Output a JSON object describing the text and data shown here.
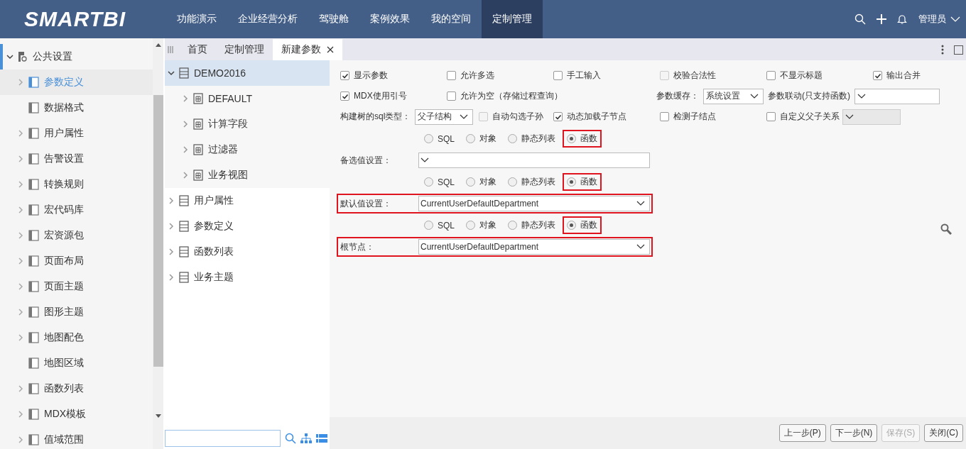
{
  "brand": {
    "logo": "SMARTBI"
  },
  "nav": [
    {
      "label": "功能演示",
      "selected": false
    },
    {
      "label": "企业经营分析",
      "selected": false
    },
    {
      "label": "驾驶舱",
      "selected": false
    },
    {
      "label": "案例效果",
      "selected": false
    },
    {
      "label": "我的空间",
      "selected": false
    },
    {
      "label": "定制管理",
      "selected": true
    }
  ],
  "user": {
    "name": "管理员"
  },
  "sidebar": {
    "items": [
      {
        "label": "公共设置",
        "expanded": true,
        "selected": false,
        "children": [
          {
            "label": "参数定义",
            "expandable": true,
            "selected": true
          },
          {
            "label": "数据格式",
            "expandable": false,
            "selected": false
          },
          {
            "label": "用户属性",
            "expandable": true,
            "selected": false
          },
          {
            "label": "告警设置",
            "expandable": true,
            "selected": false
          },
          {
            "label": "转换规则",
            "expandable": true,
            "selected": false
          },
          {
            "label": "宏代码库",
            "expandable": true,
            "selected": false
          },
          {
            "label": "宏资源包",
            "expandable": true,
            "selected": false
          },
          {
            "label": "页面布局",
            "expandable": true,
            "selected": false
          },
          {
            "label": "页面主题",
            "expandable": true,
            "selected": false
          },
          {
            "label": "图形主题",
            "expandable": true,
            "selected": false
          },
          {
            "label": "地图配色",
            "expandable": true,
            "selected": false
          },
          {
            "label": "地图区域",
            "expandable": false,
            "selected": false
          },
          {
            "label": "函数列表",
            "expandable": true,
            "selected": false
          },
          {
            "label": "MDX模板",
            "expandable": true,
            "selected": false
          },
          {
            "label": "值域范围",
            "expandable": true,
            "selected": false
          }
        ]
      }
    ]
  },
  "tabs": [
    {
      "label": "首页",
      "selected": false,
      "closable": false
    },
    {
      "label": "定制管理",
      "selected": false,
      "closable": false
    },
    {
      "label": "新建参数",
      "selected": true,
      "closable": true
    }
  ],
  "tree": {
    "items": [
      {
        "label": "DEMO2016",
        "expanded": true,
        "selected": true,
        "children": [
          {
            "label": "DEFAULT",
            "expanded": false,
            "selected": false
          },
          {
            "label": "计算字段",
            "expanded": false,
            "selected": false
          },
          {
            "label": "过滤器",
            "expanded": false,
            "selected": false
          },
          {
            "label": "业务视图",
            "expanded": false,
            "selected": false
          }
        ]
      },
      {
        "label": "用户属性",
        "expanded": false,
        "selected": false
      },
      {
        "label": "参数定义",
        "expanded": false,
        "selected": false
      },
      {
        "label": "函数列表",
        "expanded": false,
        "selected": false
      },
      {
        "label": "业务主题",
        "expanded": false,
        "selected": false
      }
    ]
  },
  "options": {
    "rows": [
      [
        {
          "kind": "checkbox",
          "label": "显示参数",
          "checked": true,
          "disabled": false
        },
        {
          "kind": "checkbox",
          "label": "允许多选",
          "checked": false,
          "disabled": false
        },
        {
          "kind": "checkbox",
          "label": "手工输入",
          "checked": false,
          "disabled": false
        },
        {
          "kind": "checkbox",
          "label": "校验合法性",
          "checked": false,
          "disabled": true
        },
        {
          "kind": "checkbox",
          "label": "不显示标题",
          "checked": false,
          "disabled": false
        },
        {
          "kind": "checkbox",
          "label": "输出合并",
          "checked": true,
          "disabled": false
        }
      ],
      [
        {
          "kind": "checkbox",
          "label": "MDX使用引号",
          "checked": true,
          "disabled": false
        },
        {
          "kind": "checkbox",
          "label": "允许为空（存储过程查询）",
          "checked": false,
          "disabled": false
        },
        "",
        {
          "kind": "select",
          "label": "参数缓存：",
          "value": "系统设置",
          "disabled": false
        },
        {
          "kind": "select",
          "label": "参数联动(只支持函数)",
          "disabled": false
        }
      ],
      [
        {
          "kind": "select",
          "label": "构建树的sql类型：",
          "value": "父子结构",
          "disabled": false
        },
        {
          "kind": "checkbox",
          "label": "自动勾选子孙",
          "checked": false,
          "disabled": true
        },
        {
          "kind": "checkbox",
          "label": "动态加载子节点",
          "checked": true,
          "disabled": false
        },
        {
          "kind": "checkbox",
          "label": "检测子结点",
          "checked": false,
          "disabled": false
        },
        {
          "kind": "checkbox",
          "label": "自定义父子关系",
          "checked": false,
          "disabled": false
        },
        {
          "kind": "select",
          "disabled": true
        }
      ]
    ]
  },
  "sections": [
    {
      "radios": [
        {
          "label": "SQL",
          "selected": false,
          "highlighted": false
        },
        {
          "label": "对象",
          "selected": false,
          "highlighted": false
        },
        {
          "label": "静态列表",
          "selected": false,
          "highlighted": false
        },
        {
          "label": "函数",
          "selected": true,
          "highlighted": true
        }
      ],
      "field": {
        "label": "备选值设置：",
        "highlighted": false
      }
    },
    {
      "radios": [
        {
          "label": "SQL",
          "selected": false,
          "highlighted": false
        },
        {
          "label": "对象",
          "selected": false,
          "highlighted": false
        },
        {
          "label": "静态列表",
          "selected": false,
          "highlighted": false
        },
        {
          "label": "函数",
          "selected": true,
          "highlighted": true
        }
      ],
      "field": {
        "label": "默认值设置：",
        "value": "CurrentUserDefaultDepartment",
        "highlighted": true
      }
    },
    {
      "radios": [
        {
          "label": "SQL",
          "selected": false,
          "highlighted": false
        },
        {
          "label": "对象",
          "selected": false,
          "highlighted": false
        },
        {
          "label": "静态列表",
          "selected": false,
          "highlighted": false
        },
        {
          "label": "函数",
          "selected": true,
          "highlighted": true
        }
      ],
      "field": {
        "label": "根节点：",
        "value": "CurrentUserDefaultDepartment",
        "highlighted": true
      }
    }
  ],
  "buttons": [
    {
      "label": "上一步(P)",
      "disabled": false
    },
    {
      "label": "下一步(N)",
      "disabled": false
    },
    {
      "label": "保存(S)",
      "disabled": true
    },
    {
      "label": "关闭(C)",
      "disabled": false
    }
  ]
}
